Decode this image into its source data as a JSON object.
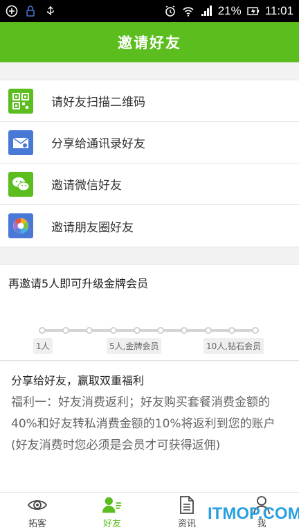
{
  "status_bar": {
    "battery": "21%",
    "time": "11:01"
  },
  "header": {
    "title": "邀请好友"
  },
  "menu": {
    "items": [
      {
        "label": "请好友扫描二维码",
        "icon": "qrcode-icon",
        "color": "#5bbd1e"
      },
      {
        "label": "分享给通讯录好友",
        "icon": "mail-icon",
        "color": "#4a78d6"
      },
      {
        "label": "邀请微信好友",
        "icon": "wechat-icon",
        "color": "#5bbd1e"
      },
      {
        "label": "邀请朋友圈好友",
        "icon": "moments-icon",
        "color": "#4a78d6"
      }
    ]
  },
  "upgrade": {
    "title": "再邀请5人即可升级金牌会员",
    "ticks": [
      "1人",
      "5人,金牌会员",
      "10人,钻石会员"
    ],
    "dot_count": 10
  },
  "benefit": {
    "title": "分享给好友，赢取双重福利",
    "body": "福利一：好友消费返利；好友购买套餐消费金额的40%和好友转私消费金额的10%将返利到您的账户(好友消费时您必须是会员才可获得返佣)"
  },
  "tabbar": {
    "tabs": [
      {
        "label": "拓客",
        "icon": "eye-icon",
        "active": false
      },
      {
        "label": "好友",
        "icon": "friends-icon",
        "active": true
      },
      {
        "label": "资讯",
        "icon": "document-icon",
        "active": false
      },
      {
        "label": "我",
        "icon": "person-icon",
        "active": false
      }
    ]
  },
  "watermark": "ITMOP.COM",
  "colors": {
    "accent": "#5bbd1e",
    "blue": "#4a78d6"
  }
}
